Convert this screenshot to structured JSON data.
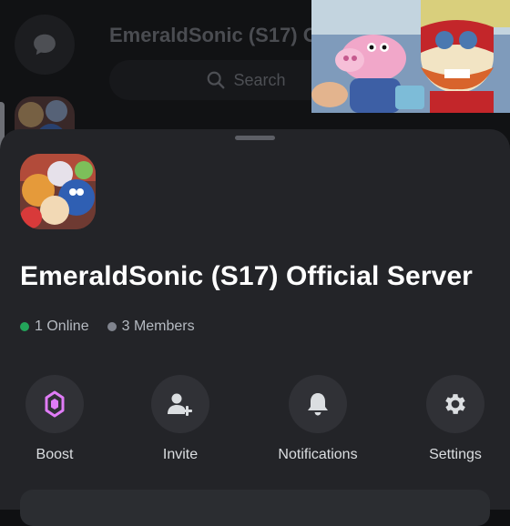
{
  "background": {
    "server_title": "EmeraldSonic (S17) O",
    "search_label": "Search"
  },
  "video_overlay": {
    "description_icon": "video-player"
  },
  "sheet": {
    "server_name": "EmeraldSonic (S17) Official Server",
    "online": "1 Online",
    "members": "3 Members",
    "online_color": "#23a55a",
    "members_color": "#80848e"
  },
  "actions": [
    {
      "id": "boost",
      "label": "Boost",
      "icon": "boost-icon"
    },
    {
      "id": "invite",
      "label": "Invite",
      "icon": "add-person-icon"
    },
    {
      "id": "notifications",
      "label": "Notifications",
      "icon": "bell-icon"
    },
    {
      "id": "settings",
      "label": "Settings",
      "icon": "gear-icon"
    }
  ],
  "colors": {
    "boost_accent": "#e07cf7",
    "sheet_bg": "#232428",
    "icon_gray": "#dbdee1"
  }
}
